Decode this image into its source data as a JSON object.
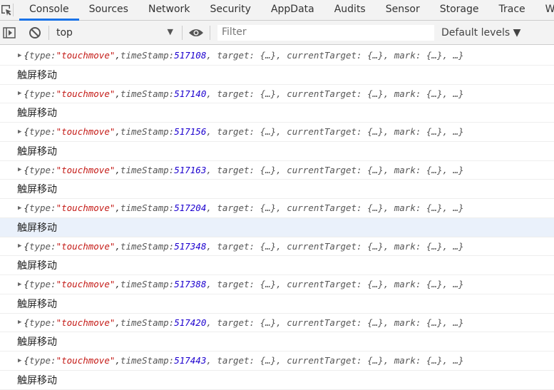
{
  "tabs": [
    {
      "label": "Console",
      "active": true
    },
    {
      "label": "Sources"
    },
    {
      "label": "Network"
    },
    {
      "label": "Security"
    },
    {
      "label": "AppData"
    },
    {
      "label": "Audits"
    },
    {
      "label": "Sensor"
    },
    {
      "label": "Storage"
    },
    {
      "label": "Trace"
    },
    {
      "label": "W"
    }
  ],
  "toolbar": {
    "context": "top",
    "filter_placeholder": "Filter",
    "levels": "Default levels ▼"
  },
  "log_text": "触屏移动",
  "events": [
    {
      "type": "\"touchmove\"",
      "timeStamp": "517108"
    },
    {
      "type": "\"touchmove\"",
      "timeStamp": "517140"
    },
    {
      "type": "\"touchmove\"",
      "timeStamp": "517156"
    },
    {
      "type": "\"touchmove\"",
      "timeStamp": "517163"
    },
    {
      "type": "\"touchmove\"",
      "timeStamp": "517204",
      "highlighted": true
    },
    {
      "type": "\"touchmove\"",
      "timeStamp": "517348"
    },
    {
      "type": "\"touchmove\"",
      "timeStamp": "517388"
    },
    {
      "type": "\"touchmove\"",
      "timeStamp": "517420"
    },
    {
      "type": "\"touchmove\"",
      "timeStamp": "517443"
    }
  ],
  "colors": {
    "accent": "#1a73e8",
    "string": "#c41a16",
    "number": "#1c00cf",
    "highlight": "#eaf1fb"
  }
}
